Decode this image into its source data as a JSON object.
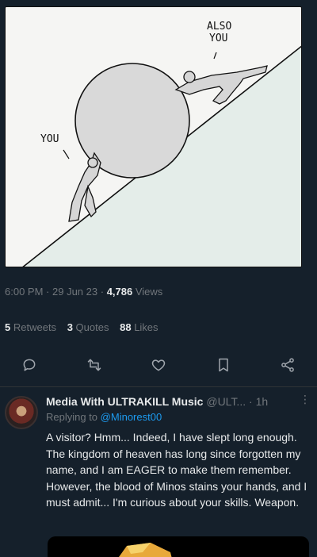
{
  "comic": {
    "label_you": "YOU",
    "label_also_you_line1": "ALSO",
    "label_also_you_line2": "YOU"
  },
  "tweet": {
    "time": "6:00 PM",
    "date": "29 Jun 23",
    "views_count": "4,786",
    "views_label": "Views",
    "retweets_count": "5",
    "retweets_label": "Retweets",
    "quotes_count": "3",
    "quotes_label": "Quotes",
    "likes_count": "88",
    "likes_label": "Likes"
  },
  "actions": {
    "reply_icon": "reply-icon",
    "retweet_icon": "retweet-icon",
    "like_icon": "heart-icon",
    "bookmark_icon": "bookmark-icon",
    "share_icon": "share-icon"
  },
  "reply": {
    "name": "Media With ULTRAKILL Music",
    "handle": "@ULT...",
    "age": "1h",
    "replying_prefix": "Replying to",
    "replying_mention": "@Minorest00",
    "text": "A visitor? Hmm... Indeed, I have slept long enough. The kingdom of heaven has long since forgotten my name, and I am EAGER to make them remember. However, the blood of Minos stains your hands, and I must admit... I'm curious about your skills. Weapon."
  },
  "colors": {
    "background": "#15202b",
    "muted": "#71767b",
    "accent": "#1d9bf0"
  }
}
